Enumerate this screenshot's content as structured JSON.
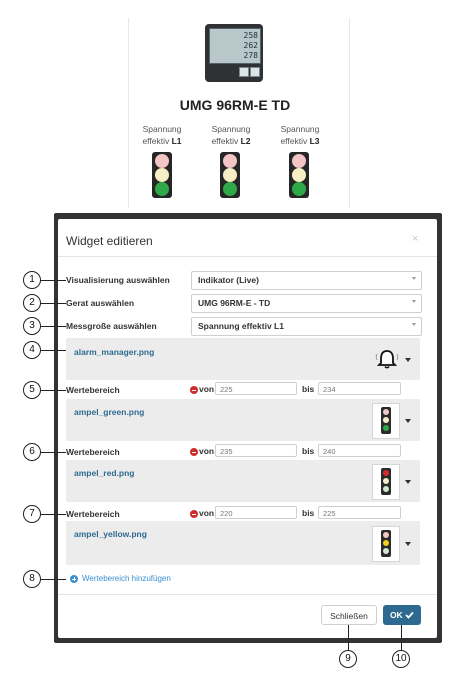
{
  "device": {
    "title": "UMG 96RM-E TD",
    "display_lines": [
      "258",
      "262",
      "278"
    ],
    "lamps": [
      {
        "label": "Spannung effektiv",
        "phase": "L1"
      },
      {
        "label": "Spannung effektiv",
        "phase": "L2"
      },
      {
        "label": "Spannung effektiv",
        "phase": "L3"
      }
    ]
  },
  "modal": {
    "title": "Widget editieren",
    "close_symbol": "×",
    "fields": [
      {
        "label": "Visualisierung auswählen",
        "value": "Indikator (Live)"
      },
      {
        "label": "Gerat auswählen",
        "value": "UMG 96RM-E - TD"
      },
      {
        "label": "Messgroße auswählen",
        "value": "Spannung effektiv L1"
      }
    ],
    "alarm_image": "alarm_manager.png",
    "ranges": [
      {
        "label": "Wertebereich",
        "from_label": "von",
        "from": "225",
        "to_label": "bis",
        "to": "234",
        "image": "ampel_green.png"
      },
      {
        "label": "Wertebereich",
        "from_label": "von",
        "from": "235",
        "to_label": "bis",
        "to": "240",
        "image": "ampel_red.png"
      },
      {
        "label": "Wertebereich",
        "from_label": "von",
        "from": "220",
        "to_label": "bis",
        "to": "225",
        "image": "ampel_yellow.png"
      }
    ],
    "add_range_label": "Wertebereich hinzufügen",
    "close_button": "Schließen",
    "ok_button": "OK"
  },
  "callouts": [
    "1",
    "2",
    "3",
    "4",
    "5",
    "6",
    "7",
    "8",
    "9",
    "10"
  ],
  "colors": {
    "accent": "#2e6a8f",
    "link": "#3a8fd1",
    "danger": "#cf2c2c",
    "overlay": "#333333"
  }
}
